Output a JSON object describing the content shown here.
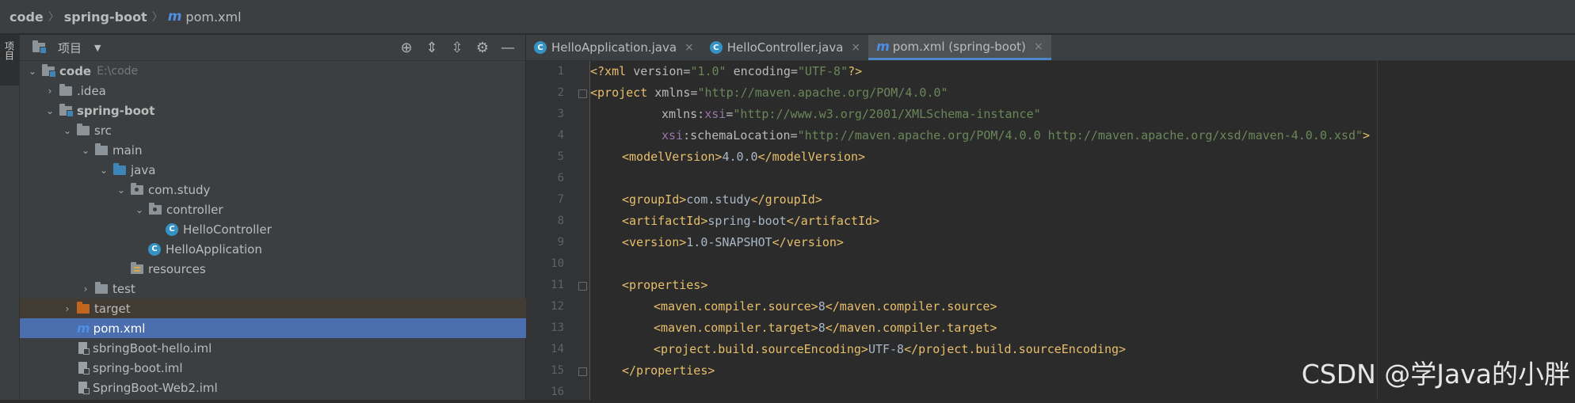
{
  "breadcrumb": {
    "root": "code",
    "module": "spring-boot",
    "file_icon": "m",
    "file": "pom.xml"
  },
  "toolstrip": {
    "project_tab": "项目"
  },
  "project_panel": {
    "title": "项目",
    "header_icons": [
      "locate-icon",
      "expand-all-icon",
      "collapse-all-icon",
      "gear-icon",
      "minimize-icon"
    ],
    "tree": [
      {
        "name": "code",
        "path": "E:\\code"
      },
      {
        "name": ".idea"
      },
      {
        "name": "spring-boot"
      },
      {
        "name": "src"
      },
      {
        "name": "main"
      },
      {
        "name": "java"
      },
      {
        "name": "com.study"
      },
      {
        "name": "controller"
      },
      {
        "name": "HelloController",
        "icon_letter": "C"
      },
      {
        "name": "HelloApplication",
        "icon_letter": "C"
      },
      {
        "name": "resources"
      },
      {
        "name": "test"
      },
      {
        "name": "target"
      },
      {
        "name": "pom.xml",
        "icon_letter": "m"
      },
      {
        "name": "sbringBoot-hello.iml"
      },
      {
        "name": "spring-boot.iml"
      },
      {
        "name": "SpringBoot-Web2.iml"
      }
    ]
  },
  "tabs": [
    {
      "label": "HelloApplication.java",
      "icon_letter": "C"
    },
    {
      "label": "HelloController.java",
      "icon_letter": "C"
    },
    {
      "label": "pom.xml (spring-boot)",
      "icon_letter": "m"
    }
  ],
  "tab_close": "×",
  "editor": {
    "line_numbers": [
      "1",
      "2",
      "3",
      "4",
      "5",
      "6",
      "7",
      "8",
      "9",
      "10",
      "11",
      "12",
      "13",
      "14",
      "15",
      "16"
    ],
    "lines": {
      "l1": {
        "decl": "<?xml ",
        "v_attr": "version=",
        "v_val": "\"1.0\"",
        "e_attr": " encoding=",
        "e_val": "\"UTF-8\"",
        "end": "?>"
      },
      "l2": {
        "open": "<project ",
        "attr": "xmlns=",
        "val": "\"http://maven.apache.org/POM/4.0.0\""
      },
      "l3": {
        "attr1": "xmlns:",
        "ns": "xsi",
        "eq": "=",
        "val": "\"http://www.w3.org/2001/XMLSchema-instance\""
      },
      "l4": {
        "ns": "xsi",
        "attr": ":schemaLocation=",
        "val": "\"http://maven.apache.org/POM/4.0.0 http://maven.apache.org/xsd/maven-4.0.0.xsd\"",
        "end": ">"
      },
      "l5": {
        "open": "<modelVersion>",
        "text": "4.0.0",
        "close": "</modelVersion>"
      },
      "l7": {
        "open": "<groupId>",
        "text": "com.study",
        "close": "</groupId>"
      },
      "l8": {
        "open": "<artifactId>",
        "text": "spring-boot",
        "close": "</artifactId>"
      },
      "l9": {
        "open": "<version>",
        "text": "1.0-SNAPSHOT",
        "close": "</version>"
      },
      "l11": {
        "open": "<properties>"
      },
      "l12": {
        "open": "<maven.compiler.source>",
        "text": "8",
        "close": "</maven.compiler.source>"
      },
      "l13": {
        "open": "<maven.compiler.target>",
        "text": "8",
        "close": "</maven.compiler.target>"
      },
      "l14": {
        "open": "<project.build.sourceEncoding>",
        "text": "UTF-8",
        "close": "</project.build.sourceEncoding>"
      },
      "l15": {
        "close": "</properties>"
      }
    }
  },
  "watermark": "CSDN @学Java的小胖",
  "colors": {
    "selection": "#4b6eaf",
    "tag": "#e8bf6a",
    "string": "#6a8759",
    "namespace": "#9876aa",
    "tab_accent": "#4a88c7"
  }
}
